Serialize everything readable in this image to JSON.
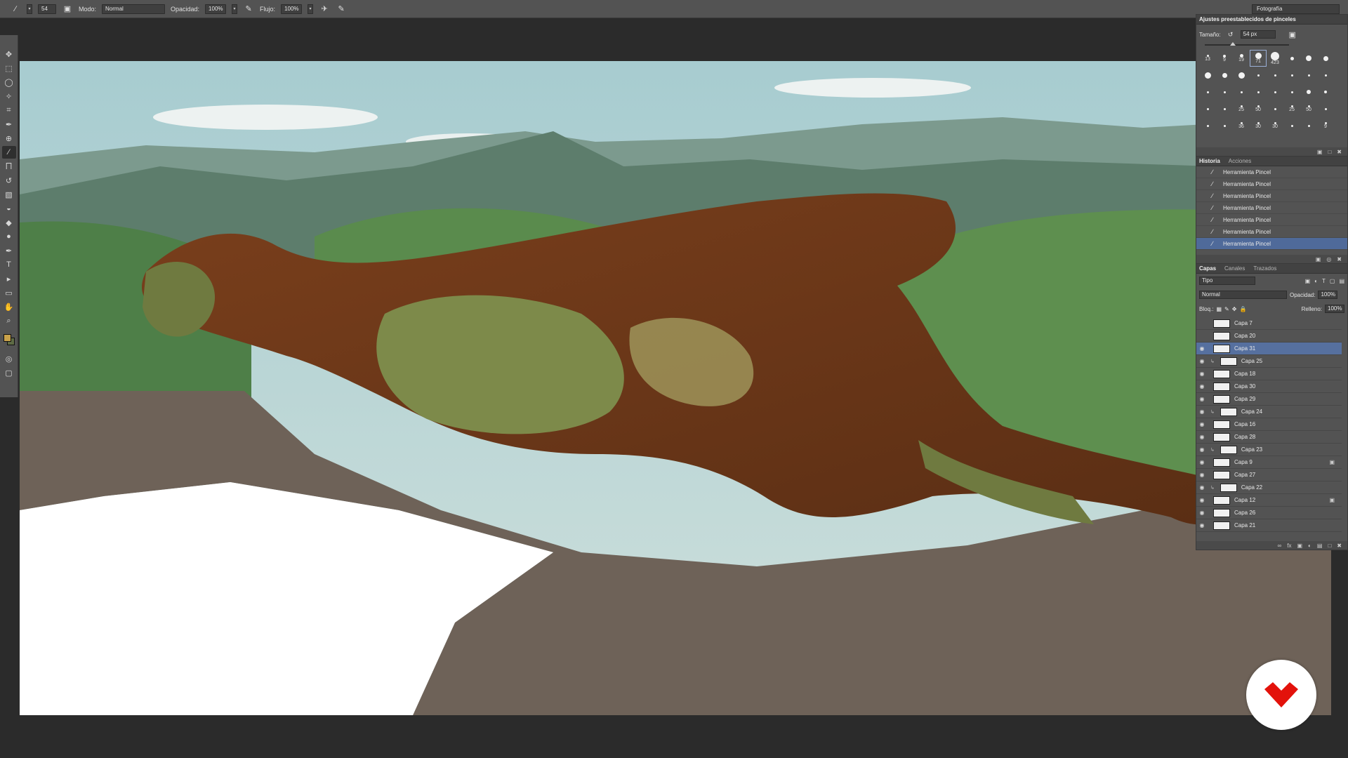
{
  "options_bar": {
    "brush_size": "54",
    "mode_label": "Modo:",
    "mode_value": "Normal",
    "opacity_label": "Opacidad:",
    "opacity_value": "100%",
    "flow_label": "Flujo:",
    "flow_value": "100%",
    "workspace": "Fotografía"
  },
  "brush_presets": {
    "title": "Ajustes preestablecidos de pinceles",
    "size_label": "Tamaño:",
    "size_value": "54 px",
    "brushes": [
      {
        "label": "13",
        "tip": 3
      },
      {
        "label": "9",
        "tip": 4
      },
      {
        "label": "19",
        "tip": 5
      },
      {
        "label": "71",
        "tip": 9,
        "selected": true
      },
      {
        "label": "423",
        "tip": 12
      },
      {
        "label": "",
        "tip": 5
      },
      {
        "label": "",
        "tip": 8
      },
      {
        "label": "",
        "tip": 7
      },
      {
        "label": "",
        "tip": 9
      },
      {
        "label": "",
        "tip": 7
      },
      {
        "label": "",
        "tip": 9
      },
      {
        "label": "",
        "tip": 3
      },
      {
        "label": "",
        "tip": 3
      },
      {
        "label": "",
        "tip": 3
      },
      {
        "label": "",
        "tip": 3
      },
      {
        "label": "",
        "tip": 3
      },
      {
        "label": "",
        "tip": 3
      },
      {
        "label": "",
        "tip": 3
      },
      {
        "label": "",
        "tip": 3
      },
      {
        "label": "",
        "tip": 3
      },
      {
        "label": "",
        "tip": 3
      },
      {
        "label": "",
        "tip": 3
      },
      {
        "label": "",
        "tip": 6
      },
      {
        "label": "",
        "tip": 4
      },
      {
        "label": "",
        "tip": 3
      },
      {
        "label": "",
        "tip": 3
      },
      {
        "label": "25",
        "tip": 3
      },
      {
        "label": "50",
        "tip": 3
      },
      {
        "label": "",
        "tip": 3
      },
      {
        "label": "25",
        "tip": 3
      },
      {
        "label": "50",
        "tip": 3
      },
      {
        "label": "",
        "tip": 3
      },
      {
        "label": "",
        "tip": 3
      },
      {
        "label": "",
        "tip": 3
      },
      {
        "label": "36",
        "tip": 3
      },
      {
        "label": "30",
        "tip": 3
      },
      {
        "label": "30",
        "tip": 3
      },
      {
        "label": "",
        "tip": 3
      },
      {
        "label": "",
        "tip": 3
      },
      {
        "label": "9",
        "tip": 3
      }
    ]
  },
  "history": {
    "tabs": [
      "Historia",
      "Acciones"
    ],
    "items": [
      "Herramienta Pincel",
      "Herramienta Pincel",
      "Herramienta Pincel",
      "Herramienta Pincel",
      "Herramienta Pincel",
      "Herramienta Pincel",
      "Herramienta Pincel"
    ]
  },
  "layers": {
    "tabs": [
      "Capas",
      "Canales",
      "Trazados"
    ],
    "filter": "Tipo",
    "blend_mode": "Normal",
    "opacity_label": "Opacidad:",
    "opacity_value": "100%",
    "lock_label": "Bloq.:",
    "fill_label": "Relleno:",
    "fill_value": "100%",
    "items": [
      {
        "name": "Capa 7",
        "visible": false,
        "clip": false,
        "locked": false
      },
      {
        "name": "Capa 20",
        "visible": false,
        "clip": false,
        "locked": false
      },
      {
        "name": "Capa 31",
        "visible": true,
        "clip": false,
        "locked": false,
        "selected": true
      },
      {
        "name": "Capa 25",
        "visible": true,
        "clip": true,
        "locked": false
      },
      {
        "name": "Capa 18",
        "visible": true,
        "clip": false,
        "locked": false
      },
      {
        "name": "Capa 30",
        "visible": true,
        "clip": false,
        "locked": false
      },
      {
        "name": "Capa 29",
        "visible": true,
        "clip": false,
        "locked": false
      },
      {
        "name": "Capa 24",
        "visible": true,
        "clip": true,
        "locked": false
      },
      {
        "name": "Capa 16",
        "visible": true,
        "clip": false,
        "locked": false
      },
      {
        "name": "Capa 28",
        "visible": true,
        "clip": false,
        "locked": false
      },
      {
        "name": "Capa 23",
        "visible": true,
        "clip": true,
        "locked": false
      },
      {
        "name": "Capa 9",
        "visible": true,
        "clip": false,
        "locked": true
      },
      {
        "name": "Capa 27",
        "visible": true,
        "clip": false,
        "locked": false
      },
      {
        "name": "Capa 22",
        "visible": true,
        "clip": true,
        "locked": false
      },
      {
        "name": "Capa 12",
        "visible": true,
        "clip": false,
        "locked": true
      },
      {
        "name": "Capa 26",
        "visible": true,
        "clip": false,
        "locked": false
      },
      {
        "name": "Capa 21",
        "visible": true,
        "clip": false,
        "locked": false
      }
    ]
  },
  "colors": {
    "foreground": "#c9a24a",
    "background": "#5e6b45",
    "selection": "#56709f",
    "logo_red": "#e3120b"
  }
}
